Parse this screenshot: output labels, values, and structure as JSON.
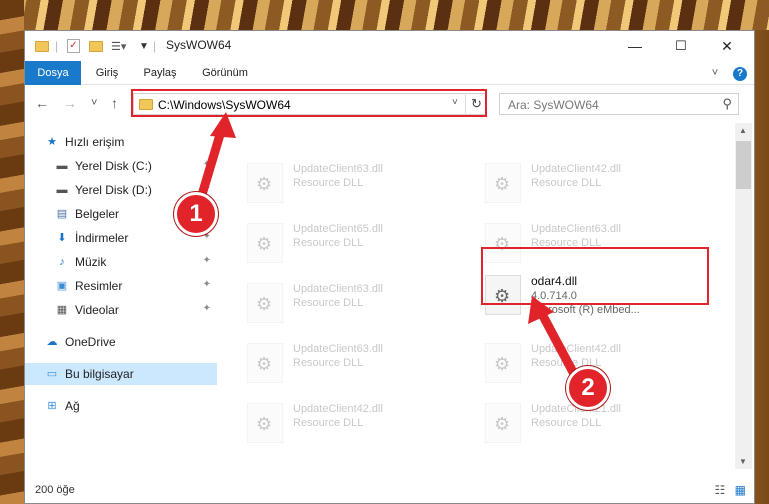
{
  "window": {
    "title": "SysWOW64",
    "minimize_glyph": "—",
    "maximize_glyph": "☐",
    "close_glyph": "✕"
  },
  "ribbon": {
    "tabs": [
      "Dosya",
      "Giriş",
      "Paylaş",
      "Görünüm"
    ],
    "expand_glyph": "˅",
    "help_glyph": "?"
  },
  "nav": {
    "back_glyph": "←",
    "forward_glyph": "→",
    "recent_glyph": "˅",
    "up_glyph": "↑"
  },
  "address": {
    "path": "C:\\Windows\\SysWOW64",
    "refresh_glyph": "↻"
  },
  "search": {
    "placeholder": "Ara: SysWOW64",
    "icon_glyph": "⚲"
  },
  "sidebar": {
    "items": [
      {
        "label": "Hızlı erişim",
        "icon": "star-icon",
        "glyph": "★",
        "color": "#1a73c8"
      },
      {
        "label": "Yerel Disk (C:)",
        "icon": "drive-icon",
        "glyph": "▬",
        "color": "#555"
      },
      {
        "label": "Yerel Disk (D:)",
        "icon": "drive-icon",
        "glyph": "▬",
        "color": "#555"
      },
      {
        "label": "Belgeler",
        "icon": "documents-icon",
        "glyph": "▤",
        "color": "#4a6fa5"
      },
      {
        "label": "İndirmeler",
        "icon": "download-icon",
        "glyph": "⬇",
        "color": "#1a73c8"
      },
      {
        "label": "Müzik",
        "icon": "music-icon",
        "glyph": "♪",
        "color": "#1a73c8"
      },
      {
        "label": "Resimler",
        "icon": "pictures-icon",
        "glyph": "▣",
        "color": "#3c8fd6"
      },
      {
        "label": "Videolar",
        "icon": "videos-icon",
        "glyph": "▦",
        "color": "#555"
      },
      {
        "label": "OneDrive",
        "icon": "cloud-icon",
        "glyph": "☁",
        "color": "#1a73c8"
      },
      {
        "label": "Bu bilgisayar",
        "icon": "computer-icon",
        "glyph": "▭",
        "color": "#3c8fd6"
      },
      {
        "label": "Ağ",
        "icon": "network-icon",
        "glyph": "⊞",
        "color": "#3c8fd6"
      }
    ],
    "pin_glyph": "✦"
  },
  "files": [
    {
      "name": "UpdateClient63.dll",
      "type": "Resource DLL"
    },
    {
      "name": "UpdateClient42.dll",
      "type": "Resource DLL"
    },
    {
      "name": "UpdateClient65.dll",
      "type": "Resource DLL"
    },
    {
      "name": "UpdateClient63.dll",
      "type": "Resource DLL"
    },
    {
      "name": "UpdateClient63.dll",
      "type": "Resource DLL"
    },
    {
      "name": "odar4.dll",
      "version": "4.0.714.0",
      "company": "Microsoft (R) eMbed..."
    },
    {
      "name": "UpdateClient63.dll",
      "type": "Resource DLL"
    },
    {
      "name": "UpdateClient42.dll",
      "type": "Resource DLL"
    },
    {
      "name": "UpdateClient42.dll",
      "type": "Resource DLL"
    },
    {
      "name": "UpdateClient21.dll",
      "type": "Resource DLL"
    }
  ],
  "status": {
    "count": "200 öğe",
    "details_glyph": "☷",
    "tiles_glyph": "▦"
  },
  "markers": [
    "1",
    "2"
  ],
  "colors": {
    "accent": "#1979ca",
    "highlight": "#e0242a",
    "selected_nav": "#cce8ff"
  }
}
